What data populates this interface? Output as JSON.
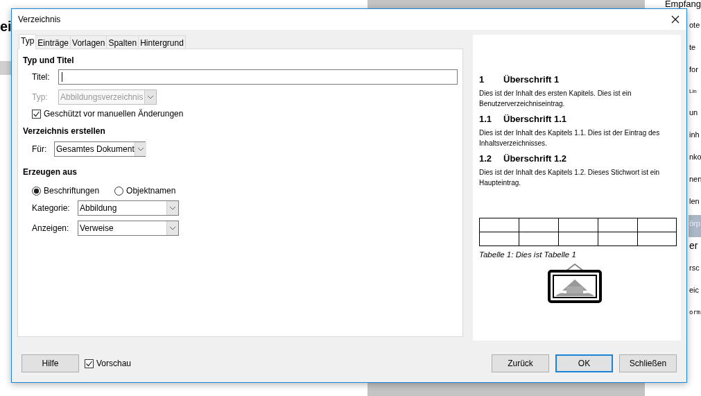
{
  "background": {
    "heading": "ei",
    "corner_label": "Empfang",
    "list_items": [
      {
        "label": "ote",
        "selected": false
      },
      {
        "label": "te",
        "selected": false
      },
      {
        "label": "for",
        "selected": false
      },
      {
        "label": "Lin",
        "selected": false,
        "kind": "small"
      },
      {
        "label": "un",
        "selected": false
      },
      {
        "label": "inh",
        "selected": false
      },
      {
        "label": "nko",
        "selected": false
      },
      {
        "label": "nen",
        "selected": false
      },
      {
        "label": "len",
        "selected": false
      },
      {
        "label": "örp",
        "selected": true
      },
      {
        "label": "er",
        "selected": false,
        "kind": "large"
      },
      {
        "label": "rsc",
        "selected": false
      },
      {
        "label": "eic",
        "selected": false
      },
      {
        "label": "orm",
        "selected": false,
        "kind": "mono"
      }
    ]
  },
  "dialog": {
    "title": "Verzeichnis",
    "tabs": [
      {
        "label": "Typ",
        "selected": true
      },
      {
        "label": "Einträge",
        "selected": false
      },
      {
        "label": "Vorlagen",
        "selected": false
      },
      {
        "label": "Spalten",
        "selected": false
      },
      {
        "label": "Hintergrund",
        "selected": false
      }
    ],
    "type_and_title": {
      "heading": "Typ und Titel",
      "title_label": "Titel:",
      "type_label": "Typ:",
      "type_value": "Abbildungsverzeichnis",
      "type_disabled": true,
      "protected": {
        "label": "Geschützt vor manuellen Änderungen",
        "checked": true
      }
    },
    "create_index": {
      "heading": "Verzeichnis erstellen",
      "for_label": "Für:",
      "for_value": "Gesamtes Dokument"
    },
    "create_from": {
      "heading": "Erzeugen aus",
      "options": [
        {
          "label": "Beschriftungen",
          "selected": true
        },
        {
          "label": "Objektnamen",
          "selected": false
        }
      ],
      "category_label": "Kategorie:",
      "category_value": "Abbildung",
      "display_label": "Anzeigen:",
      "display_value": "Verweise"
    },
    "preview": {
      "sections": [
        {
          "number": "1",
          "heading": "Überschrift 1",
          "text": "Dies ist der Inhalt des ersten Kapitels. Dies ist ein Benutzerverzeichniseintrag."
        },
        {
          "number": "1.1",
          "heading": "Überschrift 1.1",
          "text": "Dies ist der Inhalt des Kapitels 1.1. Dies ist der Eintrag des Inhaltsverzeichnisses."
        },
        {
          "number": "1.2",
          "heading": "Überschrift 1.2",
          "text": "Dies ist der Inhalt des Kapitels 1.2. Dieses Stichwort ist ein Haupteintrag."
        }
      ],
      "caption": "Tabelle 1: Dies ist Tabelle 1"
    },
    "footer": {
      "help": "Hilfe",
      "preview_toggle": {
        "label": "Vorschau",
        "checked": true
      },
      "buttons": [
        {
          "label": "Zurück",
          "default": false
        },
        {
          "label": "OK",
          "default": true
        },
        {
          "label": "Schließen",
          "default": false
        }
      ]
    }
  }
}
